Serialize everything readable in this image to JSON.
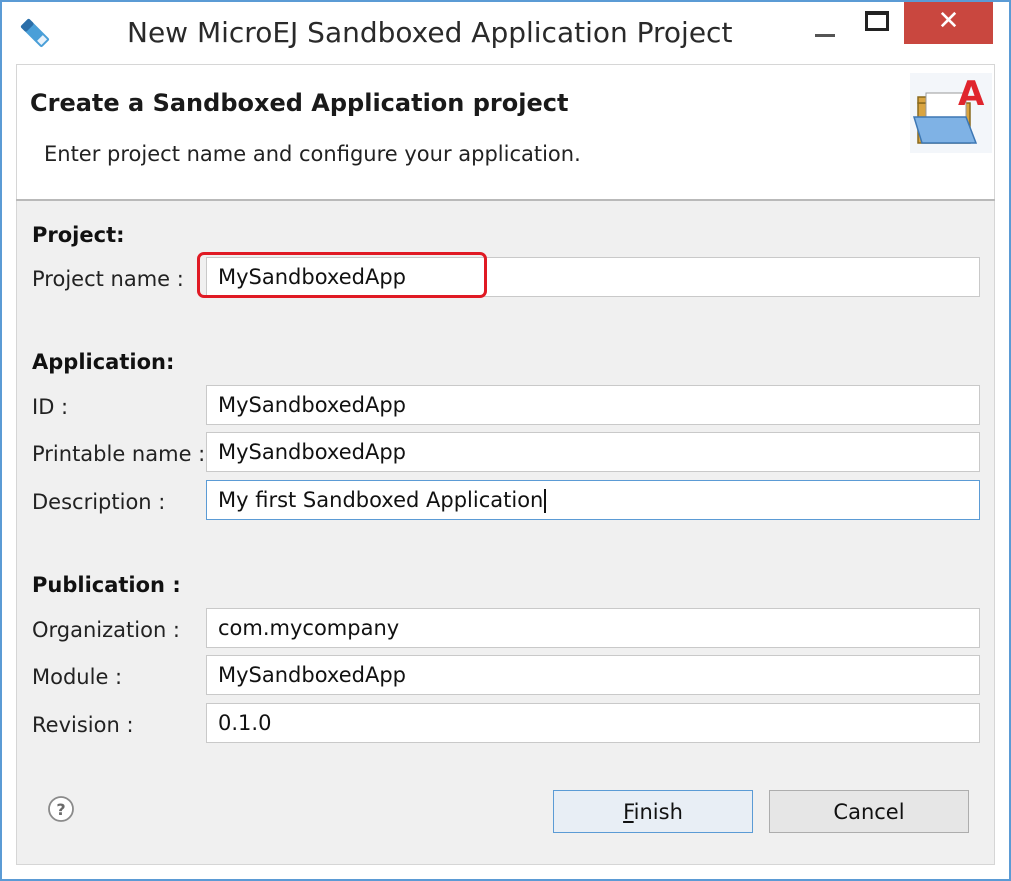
{
  "window": {
    "title": "New MicroEJ Sandboxed Application Project",
    "close_glyph": "✕",
    "accent_color": "#5b9bd5",
    "close_color": "#c9473f"
  },
  "banner": {
    "title": "Create a Sandboxed Application project",
    "description": "Enter project name and configure your application.",
    "icon": "new-folder-wizard-icon"
  },
  "project": {
    "section_title": "Project:",
    "name_label": "Project name :",
    "name_value": "MySandboxedApp"
  },
  "application": {
    "section_title": "Application:",
    "id_label": "ID :",
    "id_value": "MySandboxedApp",
    "printable_name_label": "Printable name :",
    "printable_name_value": "MySandboxedApp",
    "description_label": "Description :",
    "description_value": "My first Sandboxed Application"
  },
  "publication": {
    "section_title": "Publication :",
    "organization_label": "Organization :",
    "organization_value": "com.mycompany",
    "module_label": "Module :",
    "module_value": "MySandboxedApp",
    "revision_label": "Revision :",
    "revision_value": "0.1.0"
  },
  "buttons": {
    "finish_label": "Finish",
    "cancel_label": "Cancel",
    "help_icon": "help-icon"
  },
  "annotation": {
    "highlight_color": "#e01a24"
  }
}
